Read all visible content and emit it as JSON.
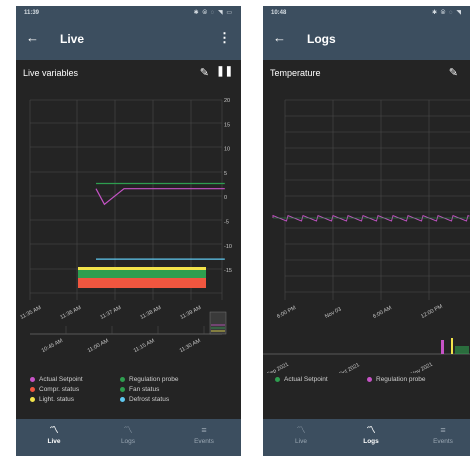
{
  "live": {
    "status": {
      "time": "11:39",
      "icons": "✱ ⦾ ◌ ◥ ▭"
    },
    "header": {
      "title": "Live"
    },
    "section": {
      "label": "Live variables"
    },
    "y_ticks": [
      "20",
      "15",
      "10",
      "5",
      "0",
      "-5",
      "-10",
      "-15"
    ],
    "x_ticks_main": [
      "11:35 AM",
      "11:36 AM",
      "11:37 AM",
      "11:38 AM",
      "11:39 AM"
    ],
    "x_ticks_overview": [
      "10:45 AM",
      "11:00 AM",
      "11:15 AM",
      "11:30 AM"
    ],
    "legend": [
      {
        "label": "Actual Setpoint",
        "color": "#c653c6"
      },
      {
        "label": "Regulation probe",
        "color": "#2e9e4f"
      },
      {
        "label": "Compr. status",
        "color": "#f0563f"
      },
      {
        "label": "Fan status",
        "color": "#2e9e4f"
      },
      {
        "label": "Light. status",
        "color": "#f2e44b"
      },
      {
        "label": "Defrost status",
        "color": "#5fc9f0"
      }
    ],
    "nav": [
      "Live",
      "Logs",
      "Events"
    ],
    "chart_data": {
      "type": "line",
      "ylim": [
        -17,
        20
      ],
      "series": [
        {
          "name": "Actual Setpoint",
          "color": "#c653c6",
          "x": [
            0,
            0.3,
            1,
            4.6
          ],
          "y": [
            3,
            0,
            3,
            3
          ]
        },
        {
          "name": "Regulation probe",
          "color": "#2e9e4f",
          "x": [
            0,
            4.6
          ],
          "y": [
            4,
            4
          ]
        },
        {
          "name": "Defrost status",
          "color": "#5fc9f0",
          "x": [
            0,
            4.6
          ],
          "y": [
            -10.5,
            -10.5
          ]
        }
      ]
    }
  },
  "logs": {
    "status": {
      "time": "10:48",
      "icons": "✱ ⦾ ◌ ◥"
    },
    "header": {
      "title": "Logs"
    },
    "section": {
      "label": "Temperature"
    },
    "x_ticks_main": [
      "6:00 PM",
      "Nov 03",
      "6:00 AM",
      "12:00 PM"
    ],
    "x_ticks_overview": [
      "Sep 2021",
      "Oct 2021",
      "Nov 2021"
    ],
    "legend": [
      {
        "label": "Actual Setpoint",
        "color": "#2e9e4f"
      },
      {
        "label": "Regulation probe",
        "color": "#c653c6"
      }
    ],
    "nav": [
      "Live",
      "Logs",
      "Events"
    ]
  }
}
